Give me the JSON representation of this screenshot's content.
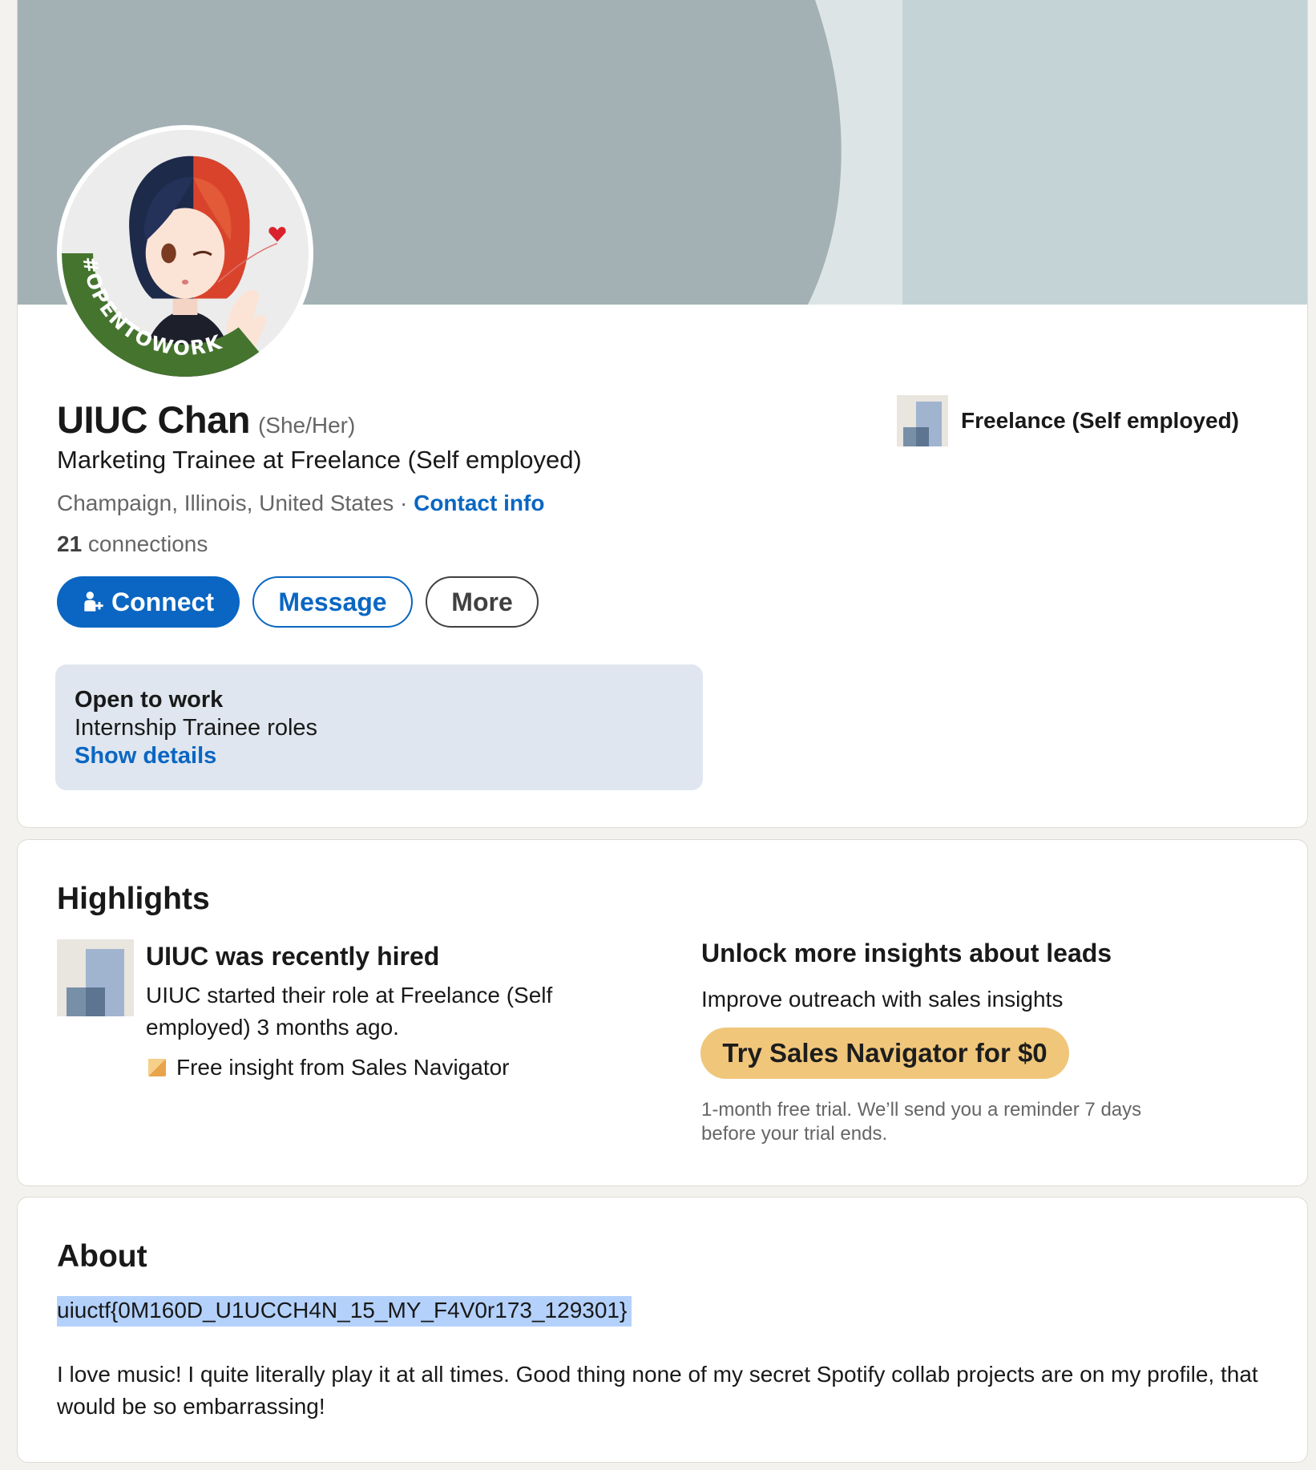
{
  "profile": {
    "name": "UIUC Chan",
    "pronouns": "(She/Her)",
    "headline": "Marketing Trainee at Freelance (Self employed)",
    "location": "Champaign, Illinois, United States",
    "separator": " · ",
    "contact_info": "Contact info",
    "connections_count": "21",
    "connections_label": " connections",
    "avatar_badge": "#OPENTOWORK",
    "company": "Freelance (Self employed)"
  },
  "actions": {
    "connect": "Connect",
    "message": "Message",
    "more": "More"
  },
  "open_to_work": {
    "title": "Open to work",
    "roles": "Internship Trainee roles",
    "link": "Show details"
  },
  "highlights": {
    "title": "Highlights",
    "item_title": "UIUC was recently hired",
    "item_desc": "UIUC started their role at Freelance (Self employed) 3 months ago.",
    "insight": "Free insight from Sales Navigator",
    "unlock_title": "Unlock more insights about leads",
    "unlock_sub": "Improve outreach with sales insights",
    "cta": "Try Sales Navigator for $0",
    "trial_note": "1-month free trial. We’ll send you a reminder 7 days before your trial ends."
  },
  "about": {
    "title": "About",
    "flag": "uiuctf{0M160D_U1UCCH4N_15_MY_F4V0r173_129301}",
    "text": "I love music! I quite literally play it at all times. Good thing none of my secret Spotify collab projects are on my profile, that would be so embarrassing!"
  },
  "colors": {
    "accent": "#0a66c2",
    "otw_green": "#45742f",
    "sales_gold": "#f0c67a",
    "banner": "#a3b1b4"
  },
  "icons": [
    "person-add-icon",
    "company-logo-icon",
    "sales-navigator-icon"
  ]
}
